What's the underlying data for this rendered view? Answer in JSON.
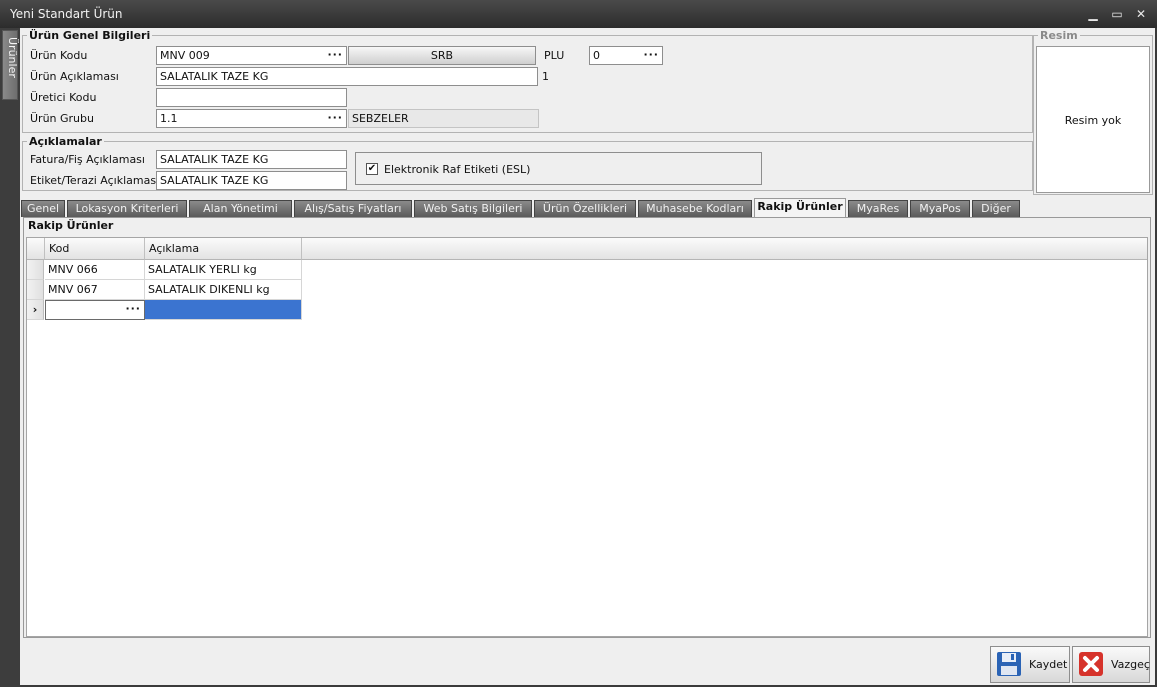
{
  "window": {
    "title": "Yeni Standart Ürün",
    "side_tab": "Ürünler"
  },
  "genel": {
    "legend": "Ürün Genel Bilgileri",
    "urun_kodu_label": "Ürün Kodu",
    "urun_kodu": "MNV 009",
    "srb_label": "SRB",
    "plu_label": "PLU",
    "plu": "0",
    "aciklama_label": "Ürün Açıklaması",
    "aciklama": "SALATALIK TAZE KG",
    "aciklama_suffix": "1",
    "uretici_label": "Üretici Kodu",
    "uretici": "",
    "grup_label": "Ürün Grubu",
    "grup": "1.1",
    "grup_adi": "SEBZELER"
  },
  "aciklamalar": {
    "legend": "Açıklamalar",
    "fatura_label": "Fatura/Fiş Açıklaması",
    "fatura": "SALATALIK TAZE KG",
    "etiket_label": "Etiket/Terazi Açıklaması",
    "etiket": "SALATALIK TAZE KG",
    "esl_label": "Elektronik Raf Etiketi (ESL)",
    "esl_checked": true
  },
  "resim": {
    "legend": "Resim",
    "empty": "Resim yok"
  },
  "tabs": [
    {
      "label": "Genel"
    },
    {
      "label": "Lokasyon Kriterleri"
    },
    {
      "label": "Alan Yönetimi"
    },
    {
      "label": "Alış/Satış Fiyatları"
    },
    {
      "label": "Web Satış Bilgileri"
    },
    {
      "label": "Ürün Özellikleri"
    },
    {
      "label": "Muhasebe Kodları"
    },
    {
      "label": "Rakip Ürünler"
    },
    {
      "label": "MyaRes"
    },
    {
      "label": "MyaPos"
    },
    {
      "label": "Diğer"
    }
  ],
  "active_tab": "Rakip Ürünler",
  "rakip": {
    "title": "Rakip Ürünler",
    "columns": [
      "Kod",
      "Açıklama"
    ],
    "rows": [
      {
        "kod": "MNV 066",
        "aciklama": "SALATALIK YERLI kg"
      },
      {
        "kod": "MNV 067",
        "aciklama": "SALATALIK DIKENLI kg"
      }
    ]
  },
  "footer": {
    "save": "Kaydet",
    "cancel": "Vazgeç"
  }
}
